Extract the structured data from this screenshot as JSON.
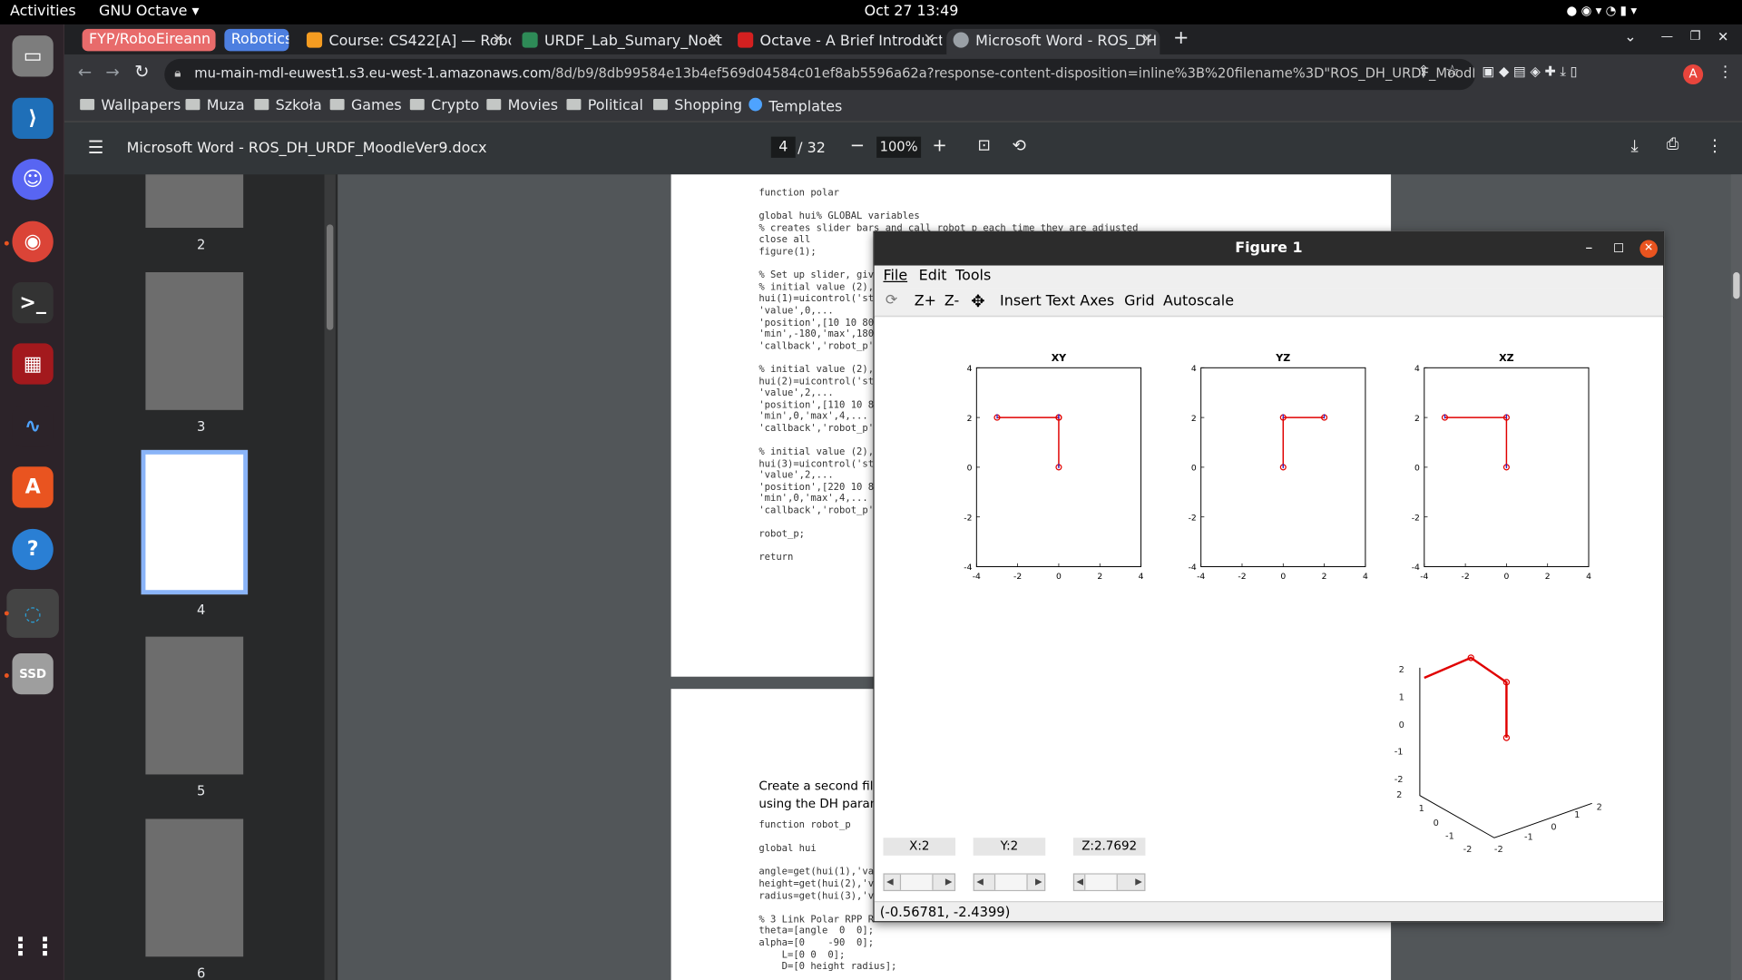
{
  "topbar": {
    "activities": "Activities",
    "app": "GNU Octave ▾",
    "datetime": "Oct 27  13:49"
  },
  "tabs": [
    {
      "label": "FYP/RoboEireann",
      "color": "#e86b6b"
    },
    {
      "label": "Robotics",
      "color": "#4d7fe0"
    },
    {
      "label": "Course: CS422[A] — Robo",
      "color": "#f59c21"
    },
    {
      "label": "URDF_Lab_Sumary_Noet",
      "color": "#2e8b57"
    },
    {
      "label": "Octave - A Brief Introduct",
      "color": "#d42020"
    },
    {
      "label": "Microsoft Word - ROS_DH",
      "color": "#9aa0a6"
    }
  ],
  "url": {
    "host": "mu-main-mdl-euwest1.s3.eu-west-1.amazonaws.com",
    "path": "/8d/b9/8db99584e13b4ef569d04584c01ef8ab5596a62a?response-content-disposition=inline%3B%20filename%3D\"ROS_DH_URDF_MoodleVer9.pdf\"&resp..."
  },
  "bookmarks": [
    "Wallpapers",
    "Muza",
    "Szkoła",
    "Games",
    "Crypto",
    "Movies",
    "Political",
    "Shopping",
    "Templates"
  ],
  "pdf": {
    "title": "Microsoft Word - ROS_DH_URDF_MoodleVer9.docx",
    "page": "4",
    "pages": "/ 32",
    "zoom": "100%"
  },
  "thumbnails": [
    "2",
    "3",
    "4",
    "5",
    "6"
  ],
  "doc": {
    "code1": "function polar\n\nglobal hui% GLOBAL variables\n% creates slider bars and call robot_p each time they are adjusted\nclose all\nfigure(1);\n\n% Set up slider, giv\n% initial value (2),\nhui(1)=uicontrol('st\n'value',0,...\n'position',[10 10 80\n'min',-180,'max',180\n'callback','robot_p'\n\n% initial value (2),\nhui(2)=uicontrol('st\n'value',2,...\n'position',[110 10 8\n'min',0,'max',4,...\n'callback','robot_p'\n\n% initial value (2),\nhui(3)=uicontrol('st\n'value',2,...\n'position',[220 10 8\n'min',0,'max',4,...\n'callback','robot_p'\n\nrobot_p;\n\nreturn",
    "para": "Create a second file c\nusing the DH parame",
    "code2": "function robot_p\n\nglobal hui\n\nangle=get(hui(1),'va\nheight=get(hui(2),'v\nradius=get(hui(3),'v\n\n% 3 Link Polar RPP R\ntheta=[angle  0  0];\nalpha=[0    -90  0];\n    L=[0 0  0];\n    D=[0 height radius];"
  },
  "figure": {
    "title": "Figure 1",
    "menu": [
      "File",
      "Edit",
      "Tools"
    ],
    "tools": [
      "Z+",
      "Z-",
      "Insert Text",
      "Axes",
      "Grid",
      "Autoscale"
    ],
    "labels": [
      "X:2",
      "Y:2",
      "Z:2.7692"
    ],
    "status": "(-0.56781, -2.4399)",
    "axis_titles": [
      "XY",
      "YZ",
      "XZ"
    ]
  },
  "chart_data": [
    {
      "type": "line",
      "title": "XY",
      "x": [
        0,
        0,
        -3,
        0
      ],
      "y": [
        0,
        2,
        2,
        2
      ],
      "xlim": [
        -4,
        4
      ],
      "ylim": [
        -4,
        4
      ],
      "ticks": [
        -4,
        -2,
        0,
        2,
        4
      ]
    },
    {
      "type": "line",
      "title": "YZ",
      "x": [
        0,
        0,
        2
      ],
      "y": [
        0,
        2,
        2
      ],
      "xlim": [
        -4,
        4
      ],
      "ylim": [
        -4,
        4
      ],
      "ticks": [
        -4,
        -2,
        0,
        2,
        4
      ]
    },
    {
      "type": "line",
      "title": "XZ",
      "x": [
        0,
        0,
        -3
      ],
      "y": [
        0,
        2,
        2
      ],
      "xlim": [
        -4,
        4
      ],
      "ylim": [
        -4,
        4
      ],
      "ticks": [
        -4,
        -2,
        0,
        2,
        4
      ]
    }
  ]
}
